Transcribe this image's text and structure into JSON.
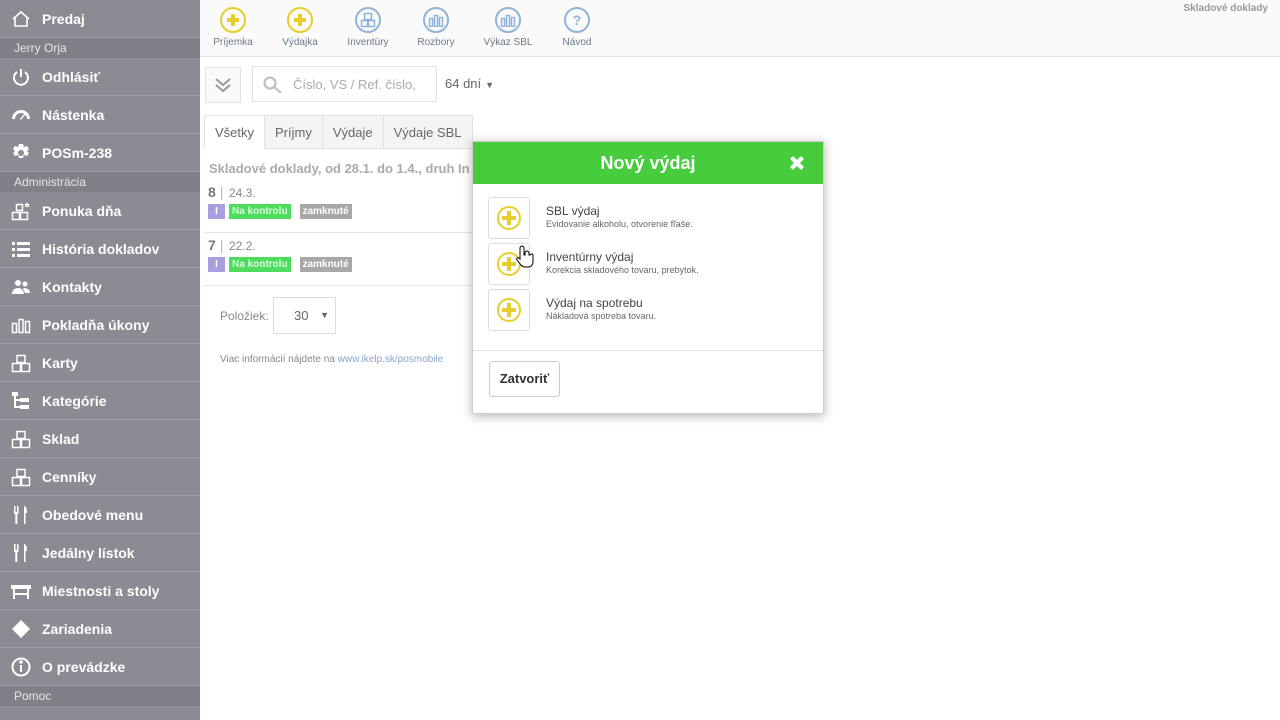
{
  "sidebar": {
    "items": [
      {
        "label": "Predaj",
        "icon": "home-icon"
      },
      {
        "section": "Jerry Orja"
      },
      {
        "label": "Odhlásiť",
        "icon": "power-icon"
      },
      {
        "label": "Nástenka",
        "icon": "dashboard-icon"
      },
      {
        "label": "POSm-238",
        "icon": "gear-icon"
      },
      {
        "section": "Administrácia"
      },
      {
        "label": "Ponuka dňa",
        "icon": "boxes-star-icon"
      },
      {
        "label": "História dokladov",
        "icon": "list-icon"
      },
      {
        "label": "Kontakty",
        "icon": "users-icon"
      },
      {
        "label": "Pokladňa úkony",
        "icon": "bars-icon"
      },
      {
        "label": "Karty",
        "icon": "boxes-icon"
      },
      {
        "label": "Kategórie",
        "icon": "tree-icon"
      },
      {
        "label": "Sklad",
        "icon": "boxes-icon"
      },
      {
        "label": "Cenníky",
        "icon": "boxes-icon"
      },
      {
        "label": "Obedové menu",
        "icon": "cutlery-icon"
      },
      {
        "label": "Jedálny lístok",
        "icon": "cutlery-icon"
      },
      {
        "label": "Miestnosti a stoly",
        "icon": "table-icon"
      },
      {
        "label": "Zariadenia",
        "icon": "diamond-icon"
      },
      {
        "label": "O prevádzke",
        "icon": "info-icon"
      },
      {
        "section": "Pomoc"
      }
    ]
  },
  "toolbar": {
    "title": "Skladové doklady",
    "buttons": [
      {
        "label": "Príjemka",
        "icon": "plus-circle-icon",
        "color": "#e6cf2c"
      },
      {
        "label": "Výdajka",
        "icon": "plus-circle-icon",
        "color": "#e6cf2c"
      },
      {
        "label": "Inventúry",
        "icon": "boxes-icon",
        "color": "#8fb3d9"
      },
      {
        "label": "Rozbory",
        "icon": "bars-icon",
        "color": "#8fb3d9"
      },
      {
        "label": "Výkaz SBL",
        "icon": "bars-icon",
        "color": "#8fb3d9"
      },
      {
        "label": "Návod",
        "icon": "help-icon",
        "color": "#8fb3d9"
      }
    ]
  },
  "filter": {
    "search_placeholder": "Číslo, VS / Ref. číslo,",
    "days": "64 dní"
  },
  "tabs": [
    "Všetky",
    "Príjmy",
    "Výdaje",
    "Výdaje SBL"
  ],
  "list": {
    "heading": "Skladové doklady, od 28.1. do 1.4., druh In",
    "docs": [
      {
        "num": "8",
        "date": "24.3.",
        "type": "I",
        "status": "Na kontrolu",
        "lock": "zamknuté"
      },
      {
        "num": "7",
        "date": "22.2.",
        "type": "I",
        "status": "Na kontrolu",
        "lock": "zamknuté"
      }
    ]
  },
  "pagination": {
    "label": "Položiek:",
    "value": "30"
  },
  "info": {
    "text": "Viac informácií nájdete na ",
    "link": "www.ikelp.sk/posmobile"
  },
  "modal": {
    "title": "Nový výdaj",
    "options": [
      {
        "title": "SBL výdaj",
        "desc": "Evidovanie alkoholu, otvorenie fľaše."
      },
      {
        "title": "Inventúrny výdaj",
        "desc": "Korekcia skladového tovaru, prebytok."
      },
      {
        "title": "Výdaj na spotrebu",
        "desc": "Nákladová spotreba tovaru."
      }
    ],
    "close_label": "Zatvoriť"
  },
  "colors": {
    "accent_green": "#46cc3c",
    "plus_yellow": "#e6cf2c",
    "sidebar": "#8b8b94"
  }
}
